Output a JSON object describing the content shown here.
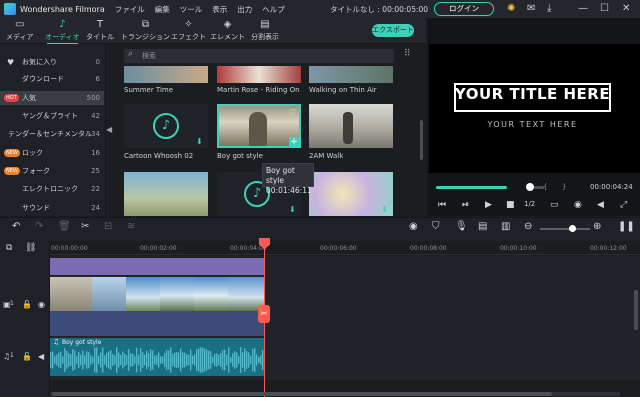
{
  "app": {
    "name": "Wondershare Filmora",
    "project_title": "タイトルなし : 00:00:05:00",
    "login_label": "ログイン"
  },
  "menu": [
    "ファイル",
    "編集",
    "ツール",
    "表示",
    "出力",
    "ヘルプ"
  ],
  "tabs": [
    {
      "label": "メディア",
      "icon": "media-icon"
    },
    {
      "label": "オーディオ",
      "icon": "music-icon",
      "active": true
    },
    {
      "label": "タイトル",
      "icon": "title-icon"
    },
    {
      "label": "トランジション",
      "icon": "transition-icon"
    },
    {
      "label": "エフェクト",
      "icon": "effect-icon"
    },
    {
      "label": "エレメント",
      "icon": "element-icon"
    },
    {
      "label": "分割表示",
      "icon": "split-icon"
    }
  ],
  "export_label": "エクスポート",
  "sidebar": [
    {
      "label": "お気に入り",
      "count": "0",
      "icon": "heart-icon"
    },
    {
      "label": "ダウンロード",
      "count": "6"
    },
    {
      "label": "人気",
      "count": "500",
      "badge": "HOT",
      "selected": true
    },
    {
      "label": "ヤング＆ブライト",
      "count": "42"
    },
    {
      "label": "テンダー＆センチメンタル",
      "count": "34"
    },
    {
      "label": "ロック",
      "count": "16",
      "badge": "NEW"
    },
    {
      "label": "フォーク",
      "count": "25",
      "badge": "NEW"
    },
    {
      "label": "エレクトロニック",
      "count": "22"
    },
    {
      "label": "サウンド",
      "count": "24"
    }
  ],
  "search": {
    "placeholder": "検索"
  },
  "media": [
    {
      "caption": "Summer Time"
    },
    {
      "caption": "Martin Rose - Riding On"
    },
    {
      "caption": "Walking on Thin Air"
    },
    {
      "caption": "Cartoon Whoosh 02"
    },
    {
      "caption": "Boy got style"
    },
    {
      "caption": "2AM Walk"
    }
  ],
  "tooltip": {
    "title": "Boy got style",
    "duration": "00:01:46:11"
  },
  "preview": {
    "title": "YOUR TITLE HERE",
    "subtitle": "YOUR TEXT HERE",
    "time": "00:00:04:24",
    "speed": "1/2",
    "progress": 0.66
  },
  "timeline": {
    "ticks": [
      "00:00:00:00",
      "00:00:02:00",
      "00:00:04:00",
      "00:00:06:00",
      "00:00:08:00",
      "00:00:10:00",
      "00:00:12:00"
    ],
    "audio_clip_label": "Boy got style",
    "video_track_label": "1",
    "audio_track_label": "1"
  }
}
